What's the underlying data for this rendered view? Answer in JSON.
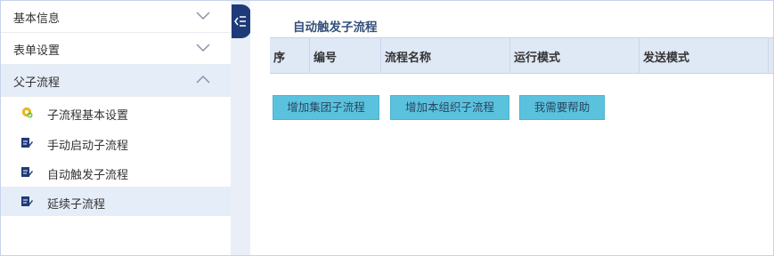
{
  "sidebar": {
    "sections": [
      {
        "label": "基本信息",
        "chevron": "chevron-down-icon"
      },
      {
        "label": "表单设置",
        "chevron": "chevron-down-icon"
      },
      {
        "label": "父子流程",
        "chevron": "chevron-up-icon"
      }
    ],
    "subitems": [
      {
        "label": "子流程基本设置",
        "icon": "gear-icon"
      },
      {
        "label": "手动启动子流程",
        "icon": "edit-icon"
      },
      {
        "label": "自动触发子流程",
        "icon": "edit-icon"
      },
      {
        "label": "延续子流程",
        "icon": "edit-icon"
      }
    ]
  },
  "main": {
    "title": "自动触发子流程",
    "table": {
      "headers": [
        "序",
        "编号",
        "流程名称",
        "运行模式",
        "发送模式"
      ]
    },
    "buttons": [
      "增加集团子流程",
      "增加本组织子流程",
      "我需要帮助"
    ]
  },
  "colors": {
    "accent": "#1f3a79",
    "button": "#5bc2de",
    "header_bg": "#dfe8f5",
    "active_bg": "#e5edf9"
  }
}
